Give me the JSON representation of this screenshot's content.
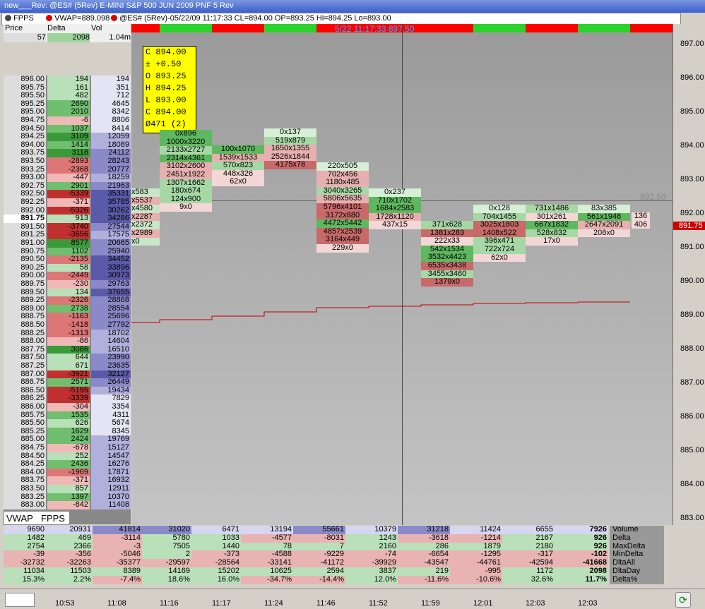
{
  "window": {
    "title": "new___Rev: @ES# (5Rev) E-MINI S&P 500 JUN 2009 PNF 5 Rev"
  },
  "infobar": {
    "fpps": "FPPS",
    "vwap": "VWAP=889.098",
    "quote": "@ES# (5Rev)-05/22/09 11:17:33 CL=894.00 OP=893.25 Hi=894.25 Lo=893.00"
  },
  "header": {
    "col_price": "Price",
    "col_delta": "Delta",
    "col_vol": "Vol",
    "val_price": "57",
    "val_delta": "2098",
    "val_vol": "1.04m"
  },
  "cursor_label": "5/22 11:17:33 897.50",
  "ohlc_box": [
    "C 894.00",
    "± +0.50",
    "O 893.25",
    "H 894.25",
    "L 893.00",
    "C 894.00",
    "Ø471 (2)"
  ],
  "price_marker": "892.50",
  "last_price": "891.75",
  "ladder": [
    [
      "896.00",
      "194",
      "194"
    ],
    [
      "895.75",
      "161",
      "351"
    ],
    [
      "895.50",
      "482",
      "712"
    ],
    [
      "895.25",
      "2690",
      "4645"
    ],
    [
      "895.00",
      "2010",
      "8342"
    ],
    [
      "894.75",
      "-6",
      "8806"
    ],
    [
      "894.50",
      "1037",
      "8414"
    ],
    [
      "894.25",
      "3109",
      "12059"
    ],
    [
      "894.00",
      "1414",
      "18089"
    ],
    [
      "893.75",
      "3118",
      "24112"
    ],
    [
      "893.50",
      "-2893",
      "28243"
    ],
    [
      "893.25",
      "-2368",
      "20777"
    ],
    [
      "893.00",
      "-447",
      "18259"
    ],
    [
      "892.75",
      "2901",
      "21963"
    ],
    [
      "892.50",
      "-5339",
      "35331"
    ],
    [
      "892.25",
      "-371",
      "35785"
    ],
    [
      "892.00",
      "-5326",
      "30262"
    ],
    [
      "891.75",
      "913",
      "34286"
    ],
    [
      "891.50",
      "-3740",
      "27544"
    ],
    [
      "891.25",
      "-3656",
      "17575"
    ],
    [
      "891.00",
      "8577",
      "20665"
    ],
    [
      "890.75",
      "1102",
      "25940"
    ],
    [
      "890.50",
      "-2135",
      "34452"
    ],
    [
      "890.25",
      "58",
      "33896"
    ],
    [
      "890.00",
      "-2449",
      "30973"
    ],
    [
      "889.75",
      "-230",
      "29763"
    ],
    [
      "889.50",
      "134",
      "37655"
    ],
    [
      "889.25",
      "-2326",
      "28868"
    ],
    [
      "889.00",
      "2738",
      "28554"
    ],
    [
      "888.75",
      "-1163",
      "25696"
    ],
    [
      "888.50",
      "-1418",
      "27792"
    ],
    [
      "888.25",
      "-1313",
      "18702"
    ],
    [
      "888.00",
      "-86",
      "14604"
    ],
    [
      "887.75",
      "3086",
      "16510"
    ],
    [
      "887.50",
      "644",
      "23990"
    ],
    [
      "887.25",
      "671",
      "23635"
    ],
    [
      "887.00",
      "-3921",
      "32127"
    ],
    [
      "886.75",
      "2571",
      "26449"
    ],
    [
      "886.50",
      "-5195",
      "19434"
    ],
    [
      "886.25",
      "-3339",
      "7829"
    ],
    [
      "886.00",
      "-304",
      "3354"
    ],
    [
      "885.75",
      "1535",
      "4311"
    ],
    [
      "885.50",
      "626",
      "5674"
    ],
    [
      "885.25",
      "1629",
      "8345"
    ],
    [
      "885.00",
      "2424",
      "19769"
    ],
    [
      "884.75",
      "-678",
      "15127"
    ],
    [
      "884.50",
      "252",
      "14547"
    ],
    [
      "884.25",
      "2436",
      "16276"
    ],
    [
      "884.00",
      "-1969",
      "17871"
    ],
    [
      "883.75",
      "-371",
      "16932"
    ],
    [
      "883.50",
      "857",
      "12911"
    ],
    [
      "883.25",
      "1397",
      "10370"
    ],
    [
      "883.00",
      "-842",
      "11408"
    ]
  ],
  "ladder_side": [
    "x583",
    "x5537",
    "x4580",
    "x2287",
    "x2372",
    "x2989",
    "x0"
  ],
  "tabs": [
    "VWAP",
    "FPPS"
  ],
  "yaxis": [
    "897.00",
    "896.00",
    "895.00",
    "894.00",
    "893.00",
    "892.00",
    "891.00",
    "890.00",
    "889.00",
    "888.00",
    "887.00",
    "886.00",
    "885.00",
    "884.00",
    "883.00"
  ],
  "columns": [
    {
      "cells": [
        "0x896",
        "1000x3220",
        "2133x2727",
        "2314x4361",
        "3102x2600",
        "2451x1922",
        "1307x1662",
        "180x674",
        "124x900",
        "9x0"
      ]
    },
    {
      "cells": [
        "100x1070",
        "1539x1533",
        "570x823",
        "448x326",
        "62x0"
      ]
    },
    {
      "cells": [
        "0x137",
        "519x879",
        "1650x1355",
        "2526x1844",
        "4175x78"
      ]
    },
    {
      "cells": [
        "220x505",
        "702x456",
        "1180x485",
        "3040x3265",
        "5806x5635",
        "5796x4101",
        "3172x880",
        "4472x5442",
        "4857x2539",
        "3164x449",
        "229x0"
      ]
    },
    {
      "cells": [
        "0x237",
        "710x1702",
        "1684x2583",
        "1728x1120",
        "437x15"
      ]
    },
    {
      "cells": [
        "371x628",
        "1381x283",
        "222x33",
        "542x1534",
        "3532x4423",
        "6535x3438",
        "3455x3460",
        "1379x0"
      ]
    },
    {
      "cells": [
        "0x128",
        "704x1455",
        "3025x1803",
        "1408x522",
        "396x471",
        "722x724",
        "62x0"
      ]
    },
    {
      "cells": [
        "731x1486",
        "301x261",
        "667x1832",
        "528x832",
        "17x0"
      ]
    },
    {
      "cells": [
        "83x385",
        "561x1948",
        "2647x2091",
        "208x0"
      ]
    }
  ],
  "last_col_side": [
    "136",
    "406"
  ],
  "stats": {
    "labels": [
      "Volume",
      "Delta",
      "MaxDelta",
      "MinDelta",
      "DltaAll",
      "DltaDay",
      "Delta%"
    ],
    "rows": [
      [
        "9690",
        "20931",
        "41814",
        "31020",
        "6471",
        "13194",
        "55661",
        "10379",
        "31218",
        "11424",
        "6655",
        "7926"
      ],
      [
        "1482",
        "469",
        "-3114",
        "5780",
        "1033",
        "-4577",
        "-8031",
        "1243",
        "-3618",
        "-1214",
        "2167",
        "926"
      ],
      [
        "2754",
        "2366",
        "-3",
        "7505",
        "1440",
        "78",
        "7",
        "2160",
        "286",
        "1879",
        "2180",
        "926"
      ],
      [
        "-39",
        "-356",
        "-5046",
        "2",
        "-373",
        "-4588",
        "-9229",
        "-74",
        "-6654",
        "-1295",
        "-317",
        "-102"
      ],
      [
        "-32732",
        "-32263",
        "-35377",
        "-29597",
        "-28564",
        "-33141",
        "-41172",
        "-39929",
        "-43547",
        "-44761",
        "-42594",
        "-41668"
      ],
      [
        "11034",
        "11503",
        "8389",
        "14169",
        "15202",
        "10625",
        "2594",
        "3837",
        "219",
        "-995",
        "1172",
        "2098"
      ],
      [
        "15.3%",
        "2.2%",
        "-7.4%",
        "18.6%",
        "16.0%",
        "-34.7%",
        "-14.4%",
        "12.0%",
        "-11.6%",
        "-10.6%",
        "32.6%",
        "11.7%"
      ]
    ]
  },
  "times": [
    "10:53",
    "11:08",
    "11:16",
    "11:17",
    "11:24",
    "11:46",
    "11:52",
    "11:59",
    "12:01",
    "12:03",
    "12:03"
  ]
}
